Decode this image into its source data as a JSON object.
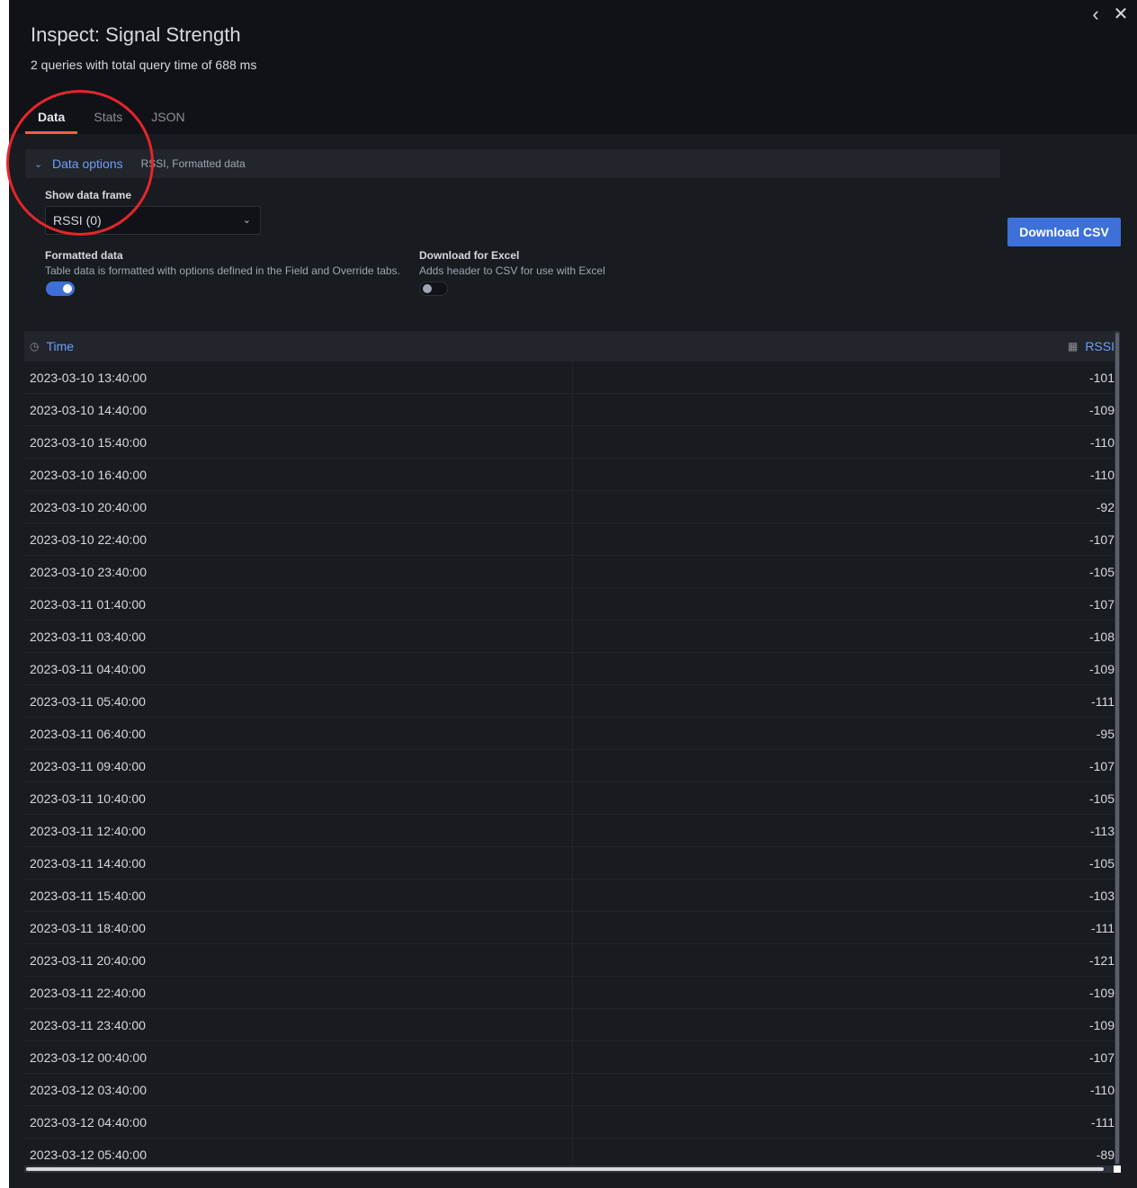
{
  "header": {
    "title": "Inspect: Signal Strength",
    "subtitle": "2 queries with total query time of 688 ms",
    "back_icon": "‹",
    "close_icon": "✕"
  },
  "tabs": [
    {
      "label": "Data",
      "active": true
    },
    {
      "label": "Stats",
      "active": false
    },
    {
      "label": "JSON",
      "active": false
    }
  ],
  "data_options": {
    "label": "Data options",
    "description": "RSSI, Formatted data",
    "expanded": true,
    "show_data_frame_label": "Show data frame",
    "selected_frame": "RSSI (0)",
    "formatted_data": {
      "label": "Formatted data",
      "description": "Table data is formatted with options defined in the Field and Override tabs.",
      "enabled": true
    },
    "download_for_excel": {
      "label": "Download for Excel",
      "description": "Adds header to CSV for use with Excel",
      "enabled": false
    }
  },
  "download_button_label": "Download CSV",
  "table": {
    "columns": [
      {
        "label": "Time",
        "icon": "clock-icon"
      },
      {
        "label": "RSSI",
        "icon": "table-icon"
      }
    ],
    "rows": [
      {
        "time": "2023-03-10 13:40:00",
        "value": "-101"
      },
      {
        "time": "2023-03-10 14:40:00",
        "value": "-109"
      },
      {
        "time": "2023-03-10 15:40:00",
        "value": "-110"
      },
      {
        "time": "2023-03-10 16:40:00",
        "value": "-110"
      },
      {
        "time": "2023-03-10 20:40:00",
        "value": "-92"
      },
      {
        "time": "2023-03-10 22:40:00",
        "value": "-107"
      },
      {
        "time": "2023-03-10 23:40:00",
        "value": "-105"
      },
      {
        "time": "2023-03-11 01:40:00",
        "value": "-107"
      },
      {
        "time": "2023-03-11 03:40:00",
        "value": "-108"
      },
      {
        "time": "2023-03-11 04:40:00",
        "value": "-109"
      },
      {
        "time": "2023-03-11 05:40:00",
        "value": "-111"
      },
      {
        "time": "2023-03-11 06:40:00",
        "value": "-95"
      },
      {
        "time": "2023-03-11 09:40:00",
        "value": "-107"
      },
      {
        "time": "2023-03-11 10:40:00",
        "value": "-105"
      },
      {
        "time": "2023-03-11 12:40:00",
        "value": "-113"
      },
      {
        "time": "2023-03-11 14:40:00",
        "value": "-105"
      },
      {
        "time": "2023-03-11 15:40:00",
        "value": "-103"
      },
      {
        "time": "2023-03-11 18:40:00",
        "value": "-111"
      },
      {
        "time": "2023-03-11 20:40:00",
        "value": "-121"
      },
      {
        "time": "2023-03-11 22:40:00",
        "value": "-109"
      },
      {
        "time": "2023-03-11 23:40:00",
        "value": "-109"
      },
      {
        "time": "2023-03-12 00:40:00",
        "value": "-107"
      },
      {
        "time": "2023-03-12 03:40:00",
        "value": "-110"
      },
      {
        "time": "2023-03-12 04:40:00",
        "value": "-111"
      },
      {
        "time": "2023-03-12 05:40:00",
        "value": "-89"
      }
    ]
  },
  "colors": {
    "accent": "#6e9fff",
    "primary_button": "#3d71d9",
    "active_tab_underline": "#f55f3e",
    "annotation_circle": "#e4262b",
    "background": "#181b1f"
  }
}
